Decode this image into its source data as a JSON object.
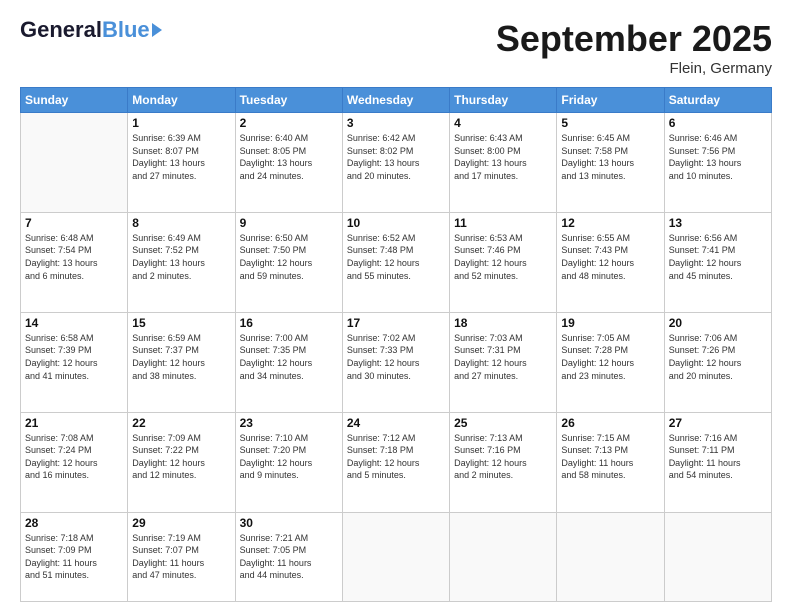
{
  "header": {
    "logo_general": "General",
    "logo_blue": "Blue",
    "month_title": "September 2025",
    "location": "Flein, Germany"
  },
  "weekdays": [
    "Sunday",
    "Monday",
    "Tuesday",
    "Wednesday",
    "Thursday",
    "Friday",
    "Saturday"
  ],
  "weeks": [
    [
      {
        "day": "",
        "info": ""
      },
      {
        "day": "1",
        "info": "Sunrise: 6:39 AM\nSunset: 8:07 PM\nDaylight: 13 hours\nand 27 minutes."
      },
      {
        "day": "2",
        "info": "Sunrise: 6:40 AM\nSunset: 8:05 PM\nDaylight: 13 hours\nand 24 minutes."
      },
      {
        "day": "3",
        "info": "Sunrise: 6:42 AM\nSunset: 8:02 PM\nDaylight: 13 hours\nand 20 minutes."
      },
      {
        "day": "4",
        "info": "Sunrise: 6:43 AM\nSunset: 8:00 PM\nDaylight: 13 hours\nand 17 minutes."
      },
      {
        "day": "5",
        "info": "Sunrise: 6:45 AM\nSunset: 7:58 PM\nDaylight: 13 hours\nand 13 minutes."
      },
      {
        "day": "6",
        "info": "Sunrise: 6:46 AM\nSunset: 7:56 PM\nDaylight: 13 hours\nand 10 minutes."
      }
    ],
    [
      {
        "day": "7",
        "info": "Sunrise: 6:48 AM\nSunset: 7:54 PM\nDaylight: 13 hours\nand 6 minutes."
      },
      {
        "day": "8",
        "info": "Sunrise: 6:49 AM\nSunset: 7:52 PM\nDaylight: 13 hours\nand 2 minutes."
      },
      {
        "day": "9",
        "info": "Sunrise: 6:50 AM\nSunset: 7:50 PM\nDaylight: 12 hours\nand 59 minutes."
      },
      {
        "day": "10",
        "info": "Sunrise: 6:52 AM\nSunset: 7:48 PM\nDaylight: 12 hours\nand 55 minutes."
      },
      {
        "day": "11",
        "info": "Sunrise: 6:53 AM\nSunset: 7:46 PM\nDaylight: 12 hours\nand 52 minutes."
      },
      {
        "day": "12",
        "info": "Sunrise: 6:55 AM\nSunset: 7:43 PM\nDaylight: 12 hours\nand 48 minutes."
      },
      {
        "day": "13",
        "info": "Sunrise: 6:56 AM\nSunset: 7:41 PM\nDaylight: 12 hours\nand 45 minutes."
      }
    ],
    [
      {
        "day": "14",
        "info": "Sunrise: 6:58 AM\nSunset: 7:39 PM\nDaylight: 12 hours\nand 41 minutes."
      },
      {
        "day": "15",
        "info": "Sunrise: 6:59 AM\nSunset: 7:37 PM\nDaylight: 12 hours\nand 38 minutes."
      },
      {
        "day": "16",
        "info": "Sunrise: 7:00 AM\nSunset: 7:35 PM\nDaylight: 12 hours\nand 34 minutes."
      },
      {
        "day": "17",
        "info": "Sunrise: 7:02 AM\nSunset: 7:33 PM\nDaylight: 12 hours\nand 30 minutes."
      },
      {
        "day": "18",
        "info": "Sunrise: 7:03 AM\nSunset: 7:31 PM\nDaylight: 12 hours\nand 27 minutes."
      },
      {
        "day": "19",
        "info": "Sunrise: 7:05 AM\nSunset: 7:28 PM\nDaylight: 12 hours\nand 23 minutes."
      },
      {
        "day": "20",
        "info": "Sunrise: 7:06 AM\nSunset: 7:26 PM\nDaylight: 12 hours\nand 20 minutes."
      }
    ],
    [
      {
        "day": "21",
        "info": "Sunrise: 7:08 AM\nSunset: 7:24 PM\nDaylight: 12 hours\nand 16 minutes."
      },
      {
        "day": "22",
        "info": "Sunrise: 7:09 AM\nSunset: 7:22 PM\nDaylight: 12 hours\nand 12 minutes."
      },
      {
        "day": "23",
        "info": "Sunrise: 7:10 AM\nSunset: 7:20 PM\nDaylight: 12 hours\nand 9 minutes."
      },
      {
        "day": "24",
        "info": "Sunrise: 7:12 AM\nSunset: 7:18 PM\nDaylight: 12 hours\nand 5 minutes."
      },
      {
        "day": "25",
        "info": "Sunrise: 7:13 AM\nSunset: 7:16 PM\nDaylight: 12 hours\nand 2 minutes."
      },
      {
        "day": "26",
        "info": "Sunrise: 7:15 AM\nSunset: 7:13 PM\nDaylight: 11 hours\nand 58 minutes."
      },
      {
        "day": "27",
        "info": "Sunrise: 7:16 AM\nSunset: 7:11 PM\nDaylight: 11 hours\nand 54 minutes."
      }
    ],
    [
      {
        "day": "28",
        "info": "Sunrise: 7:18 AM\nSunset: 7:09 PM\nDaylight: 11 hours\nand 51 minutes."
      },
      {
        "day": "29",
        "info": "Sunrise: 7:19 AM\nSunset: 7:07 PM\nDaylight: 11 hours\nand 47 minutes."
      },
      {
        "day": "30",
        "info": "Sunrise: 7:21 AM\nSunset: 7:05 PM\nDaylight: 11 hours\nand 44 minutes."
      },
      {
        "day": "",
        "info": ""
      },
      {
        "day": "",
        "info": ""
      },
      {
        "day": "",
        "info": ""
      },
      {
        "day": "",
        "info": ""
      }
    ]
  ]
}
